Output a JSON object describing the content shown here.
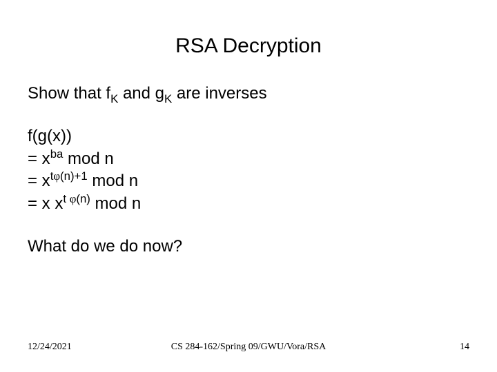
{
  "title": "RSA Decryption",
  "intro": {
    "pre": "Show that f",
    "sub1": "K",
    "mid": " and g",
    "sub2": "K",
    "post": " are inverses"
  },
  "eq": {
    "l1": "f(g(x))",
    "l2": {
      "pre": "= x",
      "sup": "ba",
      "post": " mod n"
    },
    "l3": {
      "pre": "= x",
      "sup_pre": "t",
      "phi": "φ",
      "sup_post": "(n)+1",
      "post": " mod n"
    },
    "l4": {
      "pre": "= x x",
      "sup_pre": "t ",
      "phi": "φ",
      "sup_post": "(n)",
      "post": " mod n"
    }
  },
  "closing": "What do we do now?",
  "footer": {
    "date": "12/24/2021",
    "course": "CS 284-162/Spring 09/GWU/Vora/RSA",
    "page": "14"
  }
}
